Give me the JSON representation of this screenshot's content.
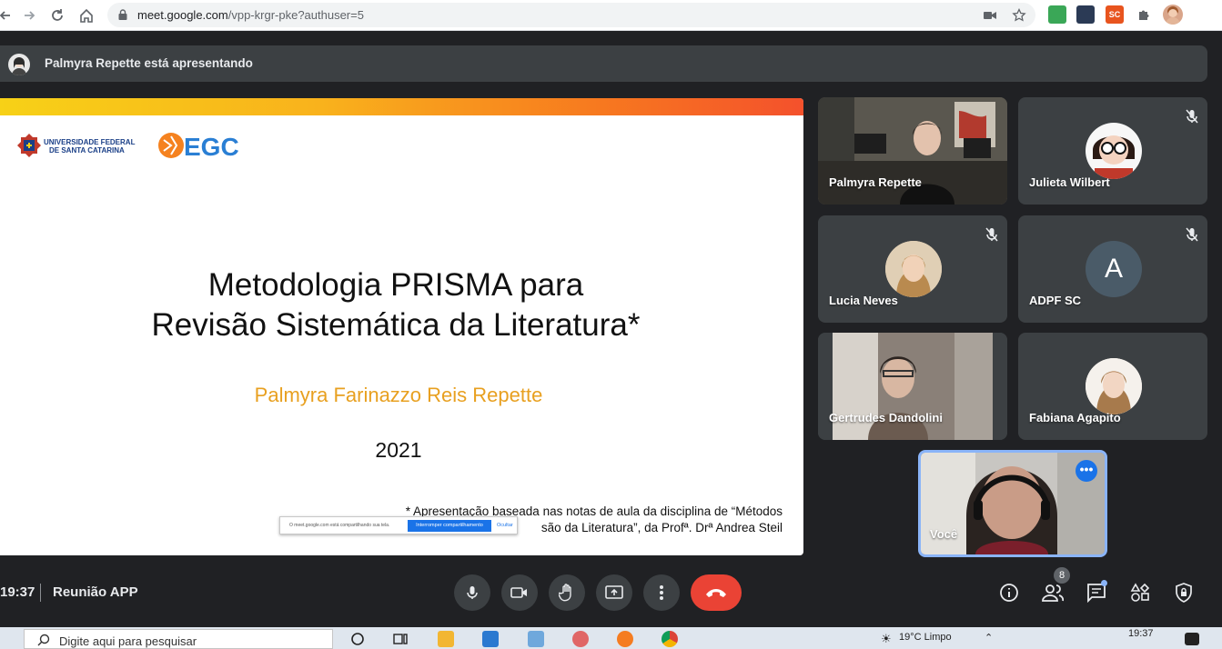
{
  "browser": {
    "url_host": "meet.google.com",
    "url_path": "/vpp-krgr-pke?authuser=5",
    "extension_sc_label": "SC"
  },
  "banner": {
    "text": "Palmyra Repette está apresentando"
  },
  "slide": {
    "ufsc_line1": "UNIVERSIDADE FEDERAL",
    "ufsc_line2": "DE SANTA CATARINA",
    "egc_logo": "EGC",
    "title_line1": "Metodologia PRISMA para",
    "title_line2": "Revisão Sistemática da Literatura*",
    "author": "Palmyra Farinazzo Reis Repette",
    "year": "2021",
    "note_line1": "* Apresentação baseada nas notas de aula da disciplina de “Métodos",
    "note_line2": "são da Literatura”, da Profª. Drª Andrea Steil",
    "share_message": "O meet.google.com está compartilhando sua tela.",
    "share_stop": "Interromper compartilhamento",
    "share_hide": "Ocultar"
  },
  "participants": [
    {
      "name": "Palmyra Repette",
      "muted": false
    },
    {
      "name": "Julieta Wilbert",
      "muted": true
    },
    {
      "name": "Lucia Neves",
      "muted": true
    },
    {
      "name": "ADPF SC",
      "muted": true,
      "initial": "A"
    },
    {
      "name": "Gertrudes Dandolini",
      "muted": false
    },
    {
      "name": "Fabiana Agapito",
      "muted": false
    },
    {
      "name": "Você",
      "muted": false
    }
  ],
  "bottom_bar": {
    "time": "19:37",
    "meeting_name": "Reunião APP",
    "participant_count": "8"
  },
  "taskbar": {
    "search_placeholder": "Digite aqui para pesquisar",
    "weather": "19°C  Limpo",
    "clock": "19:37"
  },
  "colors": {
    "accent_blue": "#1a73e8",
    "end_call_red": "#ea4335",
    "author_orange": "#e8a020"
  }
}
